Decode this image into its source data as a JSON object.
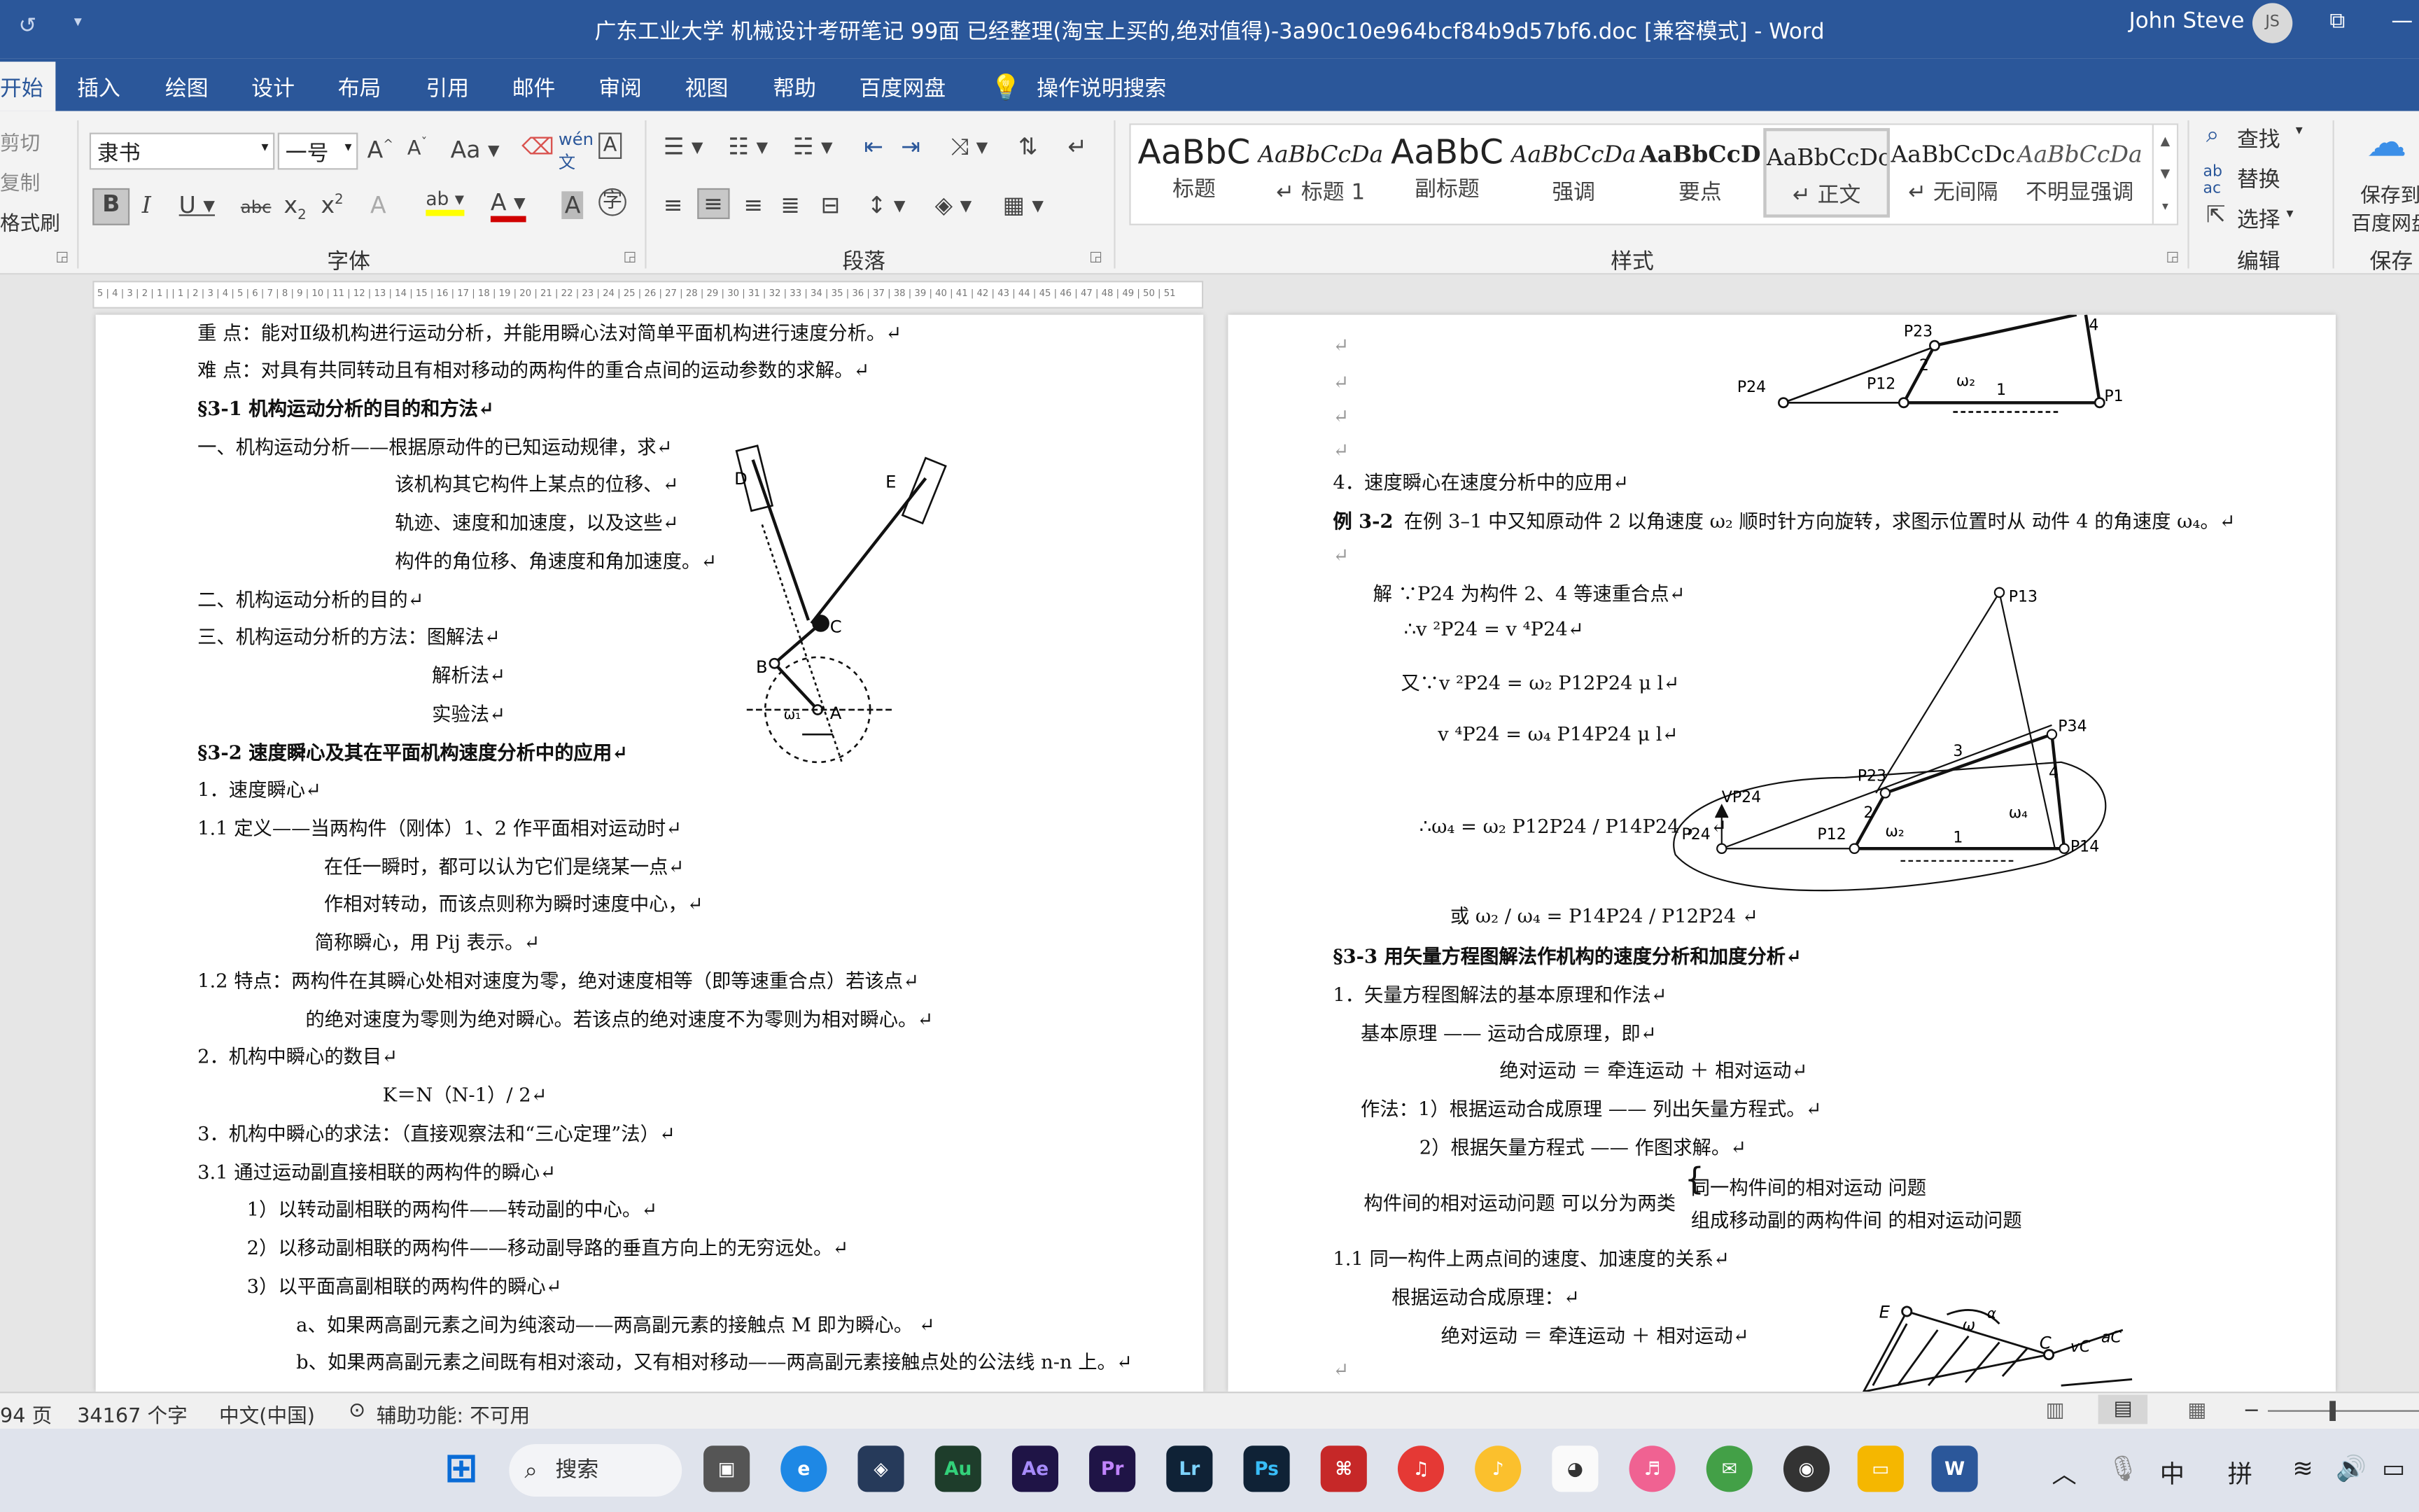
{
  "titlebar": {
    "title": "广东工业大学 机械设计考研笔记  99面 已经整理(淘宝上买的,绝对值得)-3a90c10e964bcf84b9d57bf6.doc [兼容模式]  -  Word",
    "user": "John Steve",
    "initials": "JS"
  },
  "tabs": [
    "开始",
    "插入",
    "绘图",
    "设计",
    "布局",
    "引用",
    "邮件",
    "审阅",
    "视图",
    "帮助",
    "百度网盘",
    "操作说明搜索"
  ],
  "ribbon": {
    "clipboard": [
      "剪切",
      "复制",
      "格式刷"
    ],
    "font_name": "隶书",
    "font_size": "一号",
    "font_group": "字体",
    "paragraph_group": "段落",
    "styles_group": "样式",
    "edit_group": "编辑",
    "save_group": "保存",
    "styles": [
      {
        "preview": "AaBbC",
        "name": "标题"
      },
      {
        "preview": "AaBbCcDa",
        "name": "↵ 标题 1"
      },
      {
        "preview": "AaBbC",
        "name": "副标题"
      },
      {
        "preview": "AaBbCcDa",
        "name": "强调"
      },
      {
        "preview": "AaBbCcD",
        "name": "要点"
      },
      {
        "preview": "AaBbCcDc",
        "name": "↵ 正文"
      },
      {
        "preview": "AaBbCcDc",
        "name": "↵ 无间隔"
      },
      {
        "preview": "AaBbCcDa",
        "name": "不明显强调"
      }
    ],
    "edit": [
      "查找",
      "替换",
      "选择"
    ],
    "save": [
      "保存到",
      "百度网盘"
    ]
  },
  "page1": {
    "lines": [
      "重    点：能对Ⅱ级机构进行运动分析，并能用瞬心法对简单平面机构进行速度分析。↵",
      "难    点：对具有共同转动且有相对移动的两构件的重合点间的运动参数的求解。↵",
      "§3-1  机构运动分析的目的和方法↵",
      "一、机构运动分析——根据原动件的已知运动规律，求↵",
      "该机构其它构件上某点的位移、↵",
      "轨迹、速度和加速度，以及这些↵",
      "构件的角位移、角速度和角加速度。↵",
      "二、机构运动分析的目的↵",
      "三、机构运动分析的方法：图解法↵",
      "解析法↵",
      "实验法↵",
      "§3-2  速度瞬心及其在平面机构速度分析中的应用↵",
      "1．速度瞬心↵",
      "1.1  定义——当两构件（刚体）1、2 作平面相对运动时↵",
      "在任一瞬时，都可以认为它们是绕某一点↵",
      "作相对转动，而该点则称为瞬时速度中心，↵",
      "简称瞬心，用 Pij 表示。↵",
      "1.2  特点：两构件在其瞬心处相对速度为零，绝对速度相等（即等速重合点）若该点↵",
      "的绝对速度为零则为绝对瞬心。若该点的绝对速度不为零则为相对瞬心。↵",
      "2．机构中瞬心的数目↵",
      "K＝N（N-1）/ 2↵",
      "3．机构中瞬心的求法：（直接观察法和“三心定理”法）↵",
      "3.1  通过运动副直接相联的两构件的瞬心↵",
      "1）以转动副相联的两构件——转动副的中心。↵",
      "2）以移动副相联的两构件——移动副导路的垂直方向上的无穷远处。↵",
      "3）以平面高副相联的两构件的瞬心↵",
      "a、如果两高副元素之间为纯滚动——两高副元素的接触点 M 即为瞬心。                    ↵",
      "b、如果两高副元素之间既有相对滚动，又有相对移动——两高副元素接触点处的公法线  n-n  上。↵"
    ],
    "fig_labels": [
      "D",
      "E",
      "C",
      "B",
      "A",
      "ω₁"
    ]
  },
  "page2": {
    "lines": [
      "4．速度瞬心在速度分析中的应用↵",
      "例 3-2",
      "在例 3–1 中又知原动件 2 以角速度 ω₂ 顺时针方向旋转，求图示位置时从          动件 4 的角速度 ω₄。↵",
      "解  ∵P24 为构件 2、4 等速重合点↵",
      "∴v ²P24 = v ⁴P24↵",
      "又∵v ²P24 =  ω₂ P12P24  μ l↵",
      "v ⁴P24 =  ω₄ P14P24  μ l↵",
      "∴ω₄ =  ω₂  P12P24 / P14P24  ，  ↵",
      "或   ω₂ / ω₄  =  P14P24 / P12P24  ↵",
      "§3-3    用矢量方程图解法作机构的速度分析和加度分析↵",
      "1．矢量方程图解法的基本原理和作法↵",
      "基本原理  ——  运动合成原理，即↵",
      "绝对运动  ＝ 牵连运动  ＋  相对运动↵",
      "作法：1）根据运动合成原理 —— 列出矢量方程式。↵",
      "2）根据矢量方程式 —— 作图求解。↵",
      "构件间的相对运动问题 可以分为两类",
      "同一构件间的相对运动 问题",
      "组成移动副的两构件间 的相对运动问题",
      "1.1  同一构件上两点间的速度、加速度的关系↵",
      "根据运动合成原理：↵",
      "绝对运动  ＝ 牵连运动  ＋  相对运动↵"
    ],
    "fig_labels": [
      "P23",
      "P24",
      "P12",
      "P14",
      "4",
      "1",
      "2",
      "ω₂",
      "P13",
      "P34",
      "3",
      "VP24",
      "ω₄",
      "E",
      "C",
      "α",
      "ω",
      "vC",
      "aC"
    ]
  },
  "status": {
    "pages": "94 页",
    "words": "34167 个字",
    "language": "中文(中国)",
    "accessibility": "辅助功能: 不可用"
  },
  "taskbar": {
    "search": "搜索",
    "apps": [
      "Au",
      "Ae",
      "Pr",
      "Lr",
      "Ps",
      "W"
    ],
    "ime": [
      "中",
      "拼"
    ]
  }
}
